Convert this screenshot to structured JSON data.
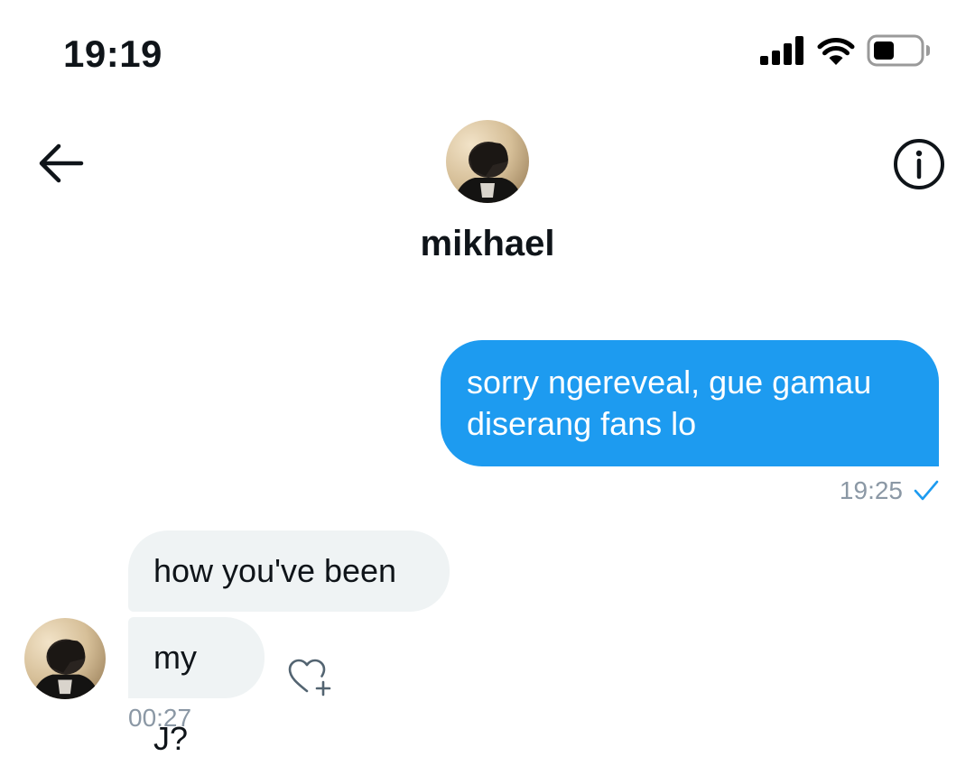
{
  "status_bar": {
    "time": "19:19",
    "icons": [
      "signal-icon",
      "wifi-icon",
      "battery-icon"
    ]
  },
  "header": {
    "name": "mikhael",
    "back_icon": "back-arrow-icon",
    "info_icon": "info-icon"
  },
  "messages": [
    {
      "direction": "sent",
      "text": "sorry ngereveal, gue gamau diserang fans lo",
      "time": "19:25",
      "status_icon": "checkmark-icon"
    },
    {
      "direction": "received",
      "text": "how you've been"
    },
    {
      "direction": "received",
      "text": "my J?",
      "time": "00:27",
      "reaction_icon": "heart-plus-icon"
    }
  ],
  "colors": {
    "accent": "#1d9bf0",
    "received_bubble": "#eff3f4",
    "meta_text": "#8b98a5",
    "text": "#0f1419"
  }
}
